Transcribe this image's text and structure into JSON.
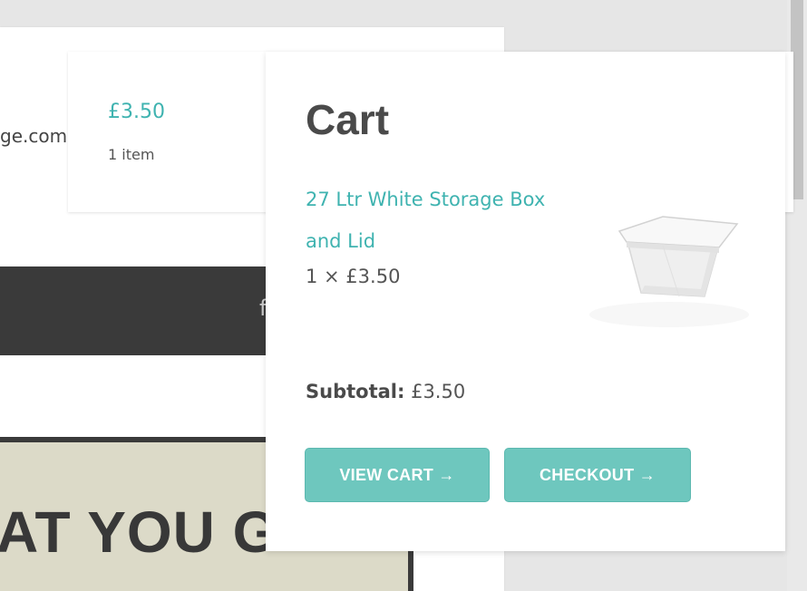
{
  "background": {
    "email_fragment": "ge.com",
    "nav_glyph": "f",
    "banner_text": "AT YOU G"
  },
  "cart_tile": {
    "total": "£3.50",
    "item_count": "1 item"
  },
  "cart_panel": {
    "title": "Cart",
    "item": {
      "name": "27 Ltr White Storage Box and Lid",
      "quantity_price": "1 × £3.50",
      "image": "storage-box-image"
    },
    "subtotal_label": "Subtotal:",
    "subtotal_value": "£3.50",
    "view_cart_label": "VIEW CART →",
    "checkout_label": "CHECKOUT →"
  },
  "colors": {
    "accent": "#3fb3b0",
    "button": "#6ec7be",
    "dark": "#3a3a3a"
  }
}
